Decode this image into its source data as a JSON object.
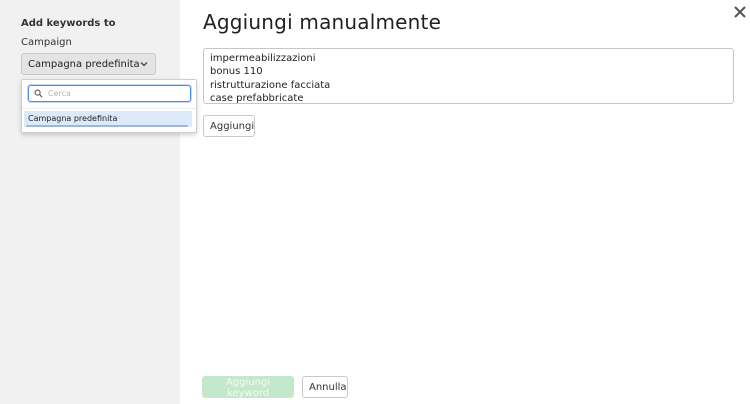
{
  "sidebar": {
    "title": "Add keywords to",
    "campaign_label": "Campaign",
    "campaign_value": "Campagna predefinita",
    "dropdown": {
      "search_placeholder": "Cerca",
      "options": [
        "Campagna predefinita"
      ]
    }
  },
  "main": {
    "title": "Aggiungi manualmente",
    "keywords_text": "impermeabilizzazioni\nbonus 110\nristrutturazione facciata\ncase prefabbricate",
    "add_button": "Aggiungi"
  },
  "footer": {
    "primary_button": "Aggiungi keyword",
    "cancel_button": "Annulla"
  },
  "colors": {
    "sidebar_bg": "#f1f1f1",
    "primary_disabled": "#c4e8cb",
    "focus_blue": "#4a8ee0",
    "option_highlight": "#dbe9f9"
  },
  "icons": [
    "chevron-down-icon",
    "search-icon",
    "close-icon"
  ]
}
